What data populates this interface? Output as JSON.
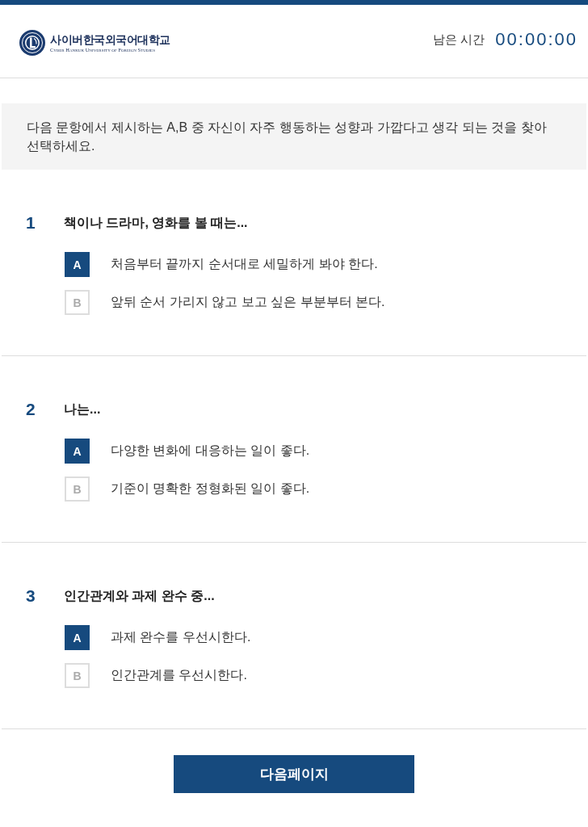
{
  "header": {
    "logo": {
      "name_ko": "사이버한국외국어대학교",
      "name_en": "Cyber Hankuk University of Foreign Studies"
    },
    "timer": {
      "label": "남은 시간",
      "value": "00:00:00"
    }
  },
  "instruction": "다음 문항에서 제시하는 A,B 중 자신이 자주 행동하는 성향과 가깝다고 생각 되는 것을 찾아 선택하세요.",
  "questions": [
    {
      "number": "1",
      "text": "책이나 드라마, 영화를 볼 때는...",
      "options": [
        {
          "letter": "A",
          "text": "처음부터 끝까지 순서대로 세밀하게 봐야 한다.",
          "selected": true
        },
        {
          "letter": "B",
          "text": "앞뒤 순서 가리지 않고 보고 싶은 부분부터 본다.",
          "selected": false
        }
      ]
    },
    {
      "number": "2",
      "text": "나는...",
      "options": [
        {
          "letter": "A",
          "text": "다양한 변화에 대응하는 일이 좋다.",
          "selected": true
        },
        {
          "letter": "B",
          "text": "기준이 명확한 정형화된 일이 좋다.",
          "selected": false
        }
      ]
    },
    {
      "number": "3",
      "text": "인간관계와 과제 완수 중...",
      "options": [
        {
          "letter": "A",
          "text": "과제 완수를 우선시한다.",
          "selected": true
        },
        {
          "letter": "B",
          "text": "인간관계를 우선시한다.",
          "selected": false
        }
      ]
    }
  ],
  "next_button": "다음페이지"
}
